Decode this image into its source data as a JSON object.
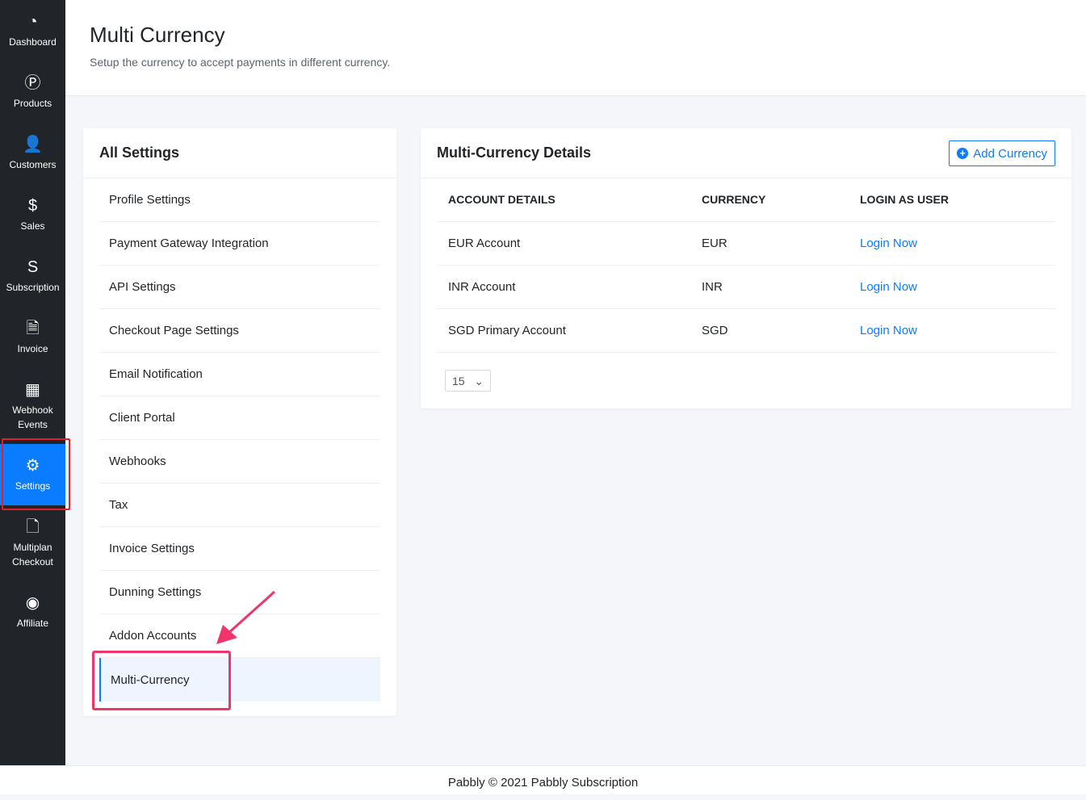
{
  "sidebar": {
    "items": [
      {
        "label": "Dashboard",
        "icon": "dashboard-icon",
        "glyph": "◔"
      },
      {
        "label": "Products",
        "icon": "products-icon",
        "glyph": "Ⓟ"
      },
      {
        "label": "Customers",
        "icon": "user-icon",
        "glyph": "👤"
      },
      {
        "label": "Sales",
        "icon": "hand-dollar-icon",
        "glyph": "$"
      },
      {
        "label": "Subscription",
        "icon": "subscription-icon",
        "glyph": "S"
      },
      {
        "label": "Invoice",
        "icon": "file-icon",
        "glyph": "🗎"
      },
      {
        "label": "Webhook Events",
        "icon": "calendar-icon",
        "glyph": "▦"
      },
      {
        "label": "Settings",
        "icon": "gear-icon",
        "glyph": "⚙"
      },
      {
        "label": "Multiplan Checkout",
        "icon": "file-icon",
        "glyph": "🗋"
      },
      {
        "label": "Affiliate",
        "icon": "podcast-icon",
        "glyph": "◉"
      }
    ],
    "active": "Settings"
  },
  "header": {
    "title": "Multi Currency",
    "subtitle": "Setup the currency to accept payments in different currency."
  },
  "settings": {
    "title": "All Settings",
    "items": [
      "Profile Settings",
      "Payment Gateway Integration",
      "API Settings",
      "Checkout Page Settings",
      "Email Notification",
      "Client Portal",
      "Webhooks",
      "Tax",
      "Invoice Settings",
      "Dunning Settings",
      "Addon Accounts",
      "Multi-Currency"
    ],
    "active": "Multi-Currency"
  },
  "details": {
    "title": "Multi-Currency Details",
    "add_label": "Add Currency",
    "columns": [
      "ACCOUNT DETAILS",
      "CURRENCY",
      "LOGIN AS USER"
    ],
    "rows": [
      {
        "account": "EUR Account",
        "currency": "EUR",
        "login": "Login Now"
      },
      {
        "account": "INR Account",
        "currency": "INR",
        "login": "Login Now"
      },
      {
        "account": "SGD Primary Account",
        "currency": "SGD",
        "login": "Login Now"
      }
    ],
    "page_size": "15"
  },
  "footer": {
    "text": "Pabbly © 2021 Pabbly Subscription"
  },
  "colors": {
    "accent": "#0a7cff",
    "sidebar": "#212529",
    "highlight": "#f0356b"
  }
}
